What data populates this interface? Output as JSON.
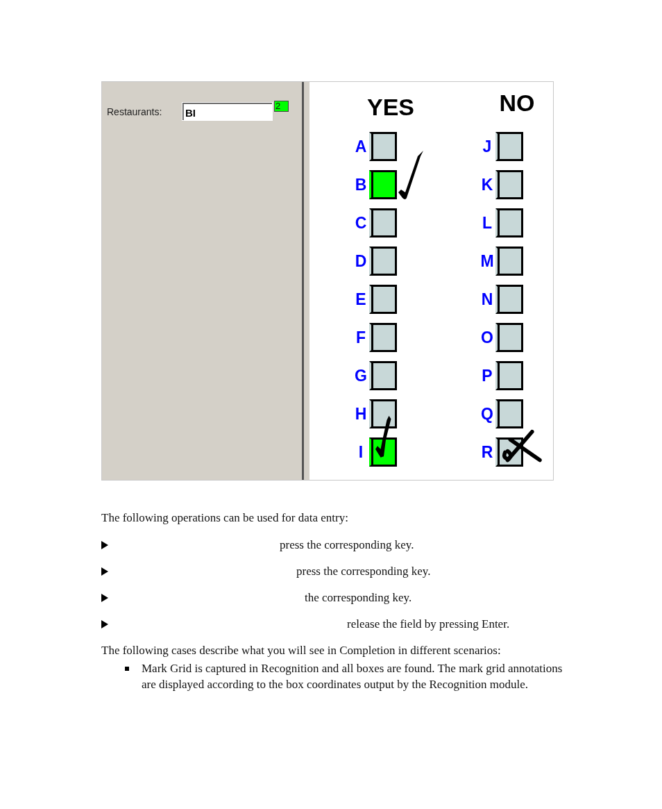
{
  "app": {
    "field_label": "Restaurants:",
    "field_value": "BI",
    "count": "2",
    "form": {
      "columns": [
        {
          "heading": "YES",
          "items": [
            {
              "letter": "A",
              "selected": false
            },
            {
              "letter": "B",
              "selected": true,
              "kind": "check"
            },
            {
              "letter": "C",
              "selected": false
            },
            {
              "letter": "D",
              "selected": false
            },
            {
              "letter": "E",
              "selected": false
            },
            {
              "letter": "F",
              "selected": false
            },
            {
              "letter": "G",
              "selected": false
            },
            {
              "letter": "H",
              "selected": false
            },
            {
              "letter": "I",
              "selected": true,
              "kind": "tall-check"
            }
          ]
        },
        {
          "heading": "NO",
          "items": [
            {
              "letter": "J",
              "selected": false
            },
            {
              "letter": "K",
              "selected": false
            },
            {
              "letter": "L",
              "selected": false
            },
            {
              "letter": "M",
              "selected": false
            },
            {
              "letter": "N",
              "selected": false
            },
            {
              "letter": "O",
              "selected": false
            },
            {
              "letter": "P",
              "selected": false
            },
            {
              "letter": "Q",
              "selected": false
            },
            {
              "letter": "R",
              "selected": false,
              "kind": "cross"
            }
          ]
        }
      ]
    }
  },
  "intro": "The following operations can be used for data entry:",
  "operations": [
    "press the corresponding key.",
    "press the corresponding key.",
    "the corresponding key.",
    "release the field by pressing Enter."
  ],
  "cases_intro": "The following cases describe what you will see in Completion in different scenarios:",
  "cases": [
    "Mark Grid is captured in Recognition and all boxes are found. The mark grid annotations are displayed according to the box coordinates output by the Recognition module."
  ]
}
